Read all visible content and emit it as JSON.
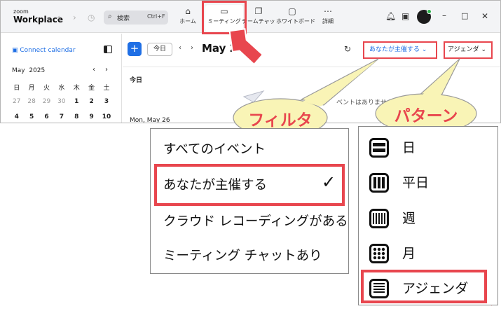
{
  "app": {
    "brand_small": "zoom",
    "brand_big": "Workplace",
    "search": {
      "label": "検索",
      "shortcut": "Ctrl+F"
    },
    "tabs": [
      {
        "label": "ホーム",
        "icon": "home-icon"
      },
      {
        "label": "ミーティング",
        "icon": "video-icon"
      },
      {
        "label": "チームチャット",
        "icon": "chat-icon"
      },
      {
        "label": "ホワイトボード",
        "icon": "whiteboard-icon"
      },
      {
        "label": "詳細",
        "icon": "more-icon"
      }
    ]
  },
  "sidebar": {
    "connect": "Connect calendar",
    "month": "May",
    "year": "2025",
    "weekdays": [
      "日",
      "月",
      "火",
      "水",
      "木",
      "金",
      "土"
    ],
    "weeks": [
      [
        "27",
        "28",
        "29",
        "30",
        "1",
        "2",
        "3"
      ],
      [
        "4",
        "5",
        "6",
        "7",
        "8",
        "9",
        "10"
      ]
    ]
  },
  "main": {
    "today_button": "今日",
    "date_title": "May 26",
    "filter_label": "あなたが主催する",
    "pattern_label": "アジェンダ",
    "today_label": "今日",
    "empty_text": "ベントはありません。",
    "day_label": "Mon, May 26"
  },
  "callouts": {
    "filter": "フィルター",
    "pattern": "パターン"
  },
  "filter_menu": {
    "items": [
      "すべてのイベント",
      "あなたが主催する",
      "クラウド レコーディングがある",
      "ミーティング チャットあり"
    ],
    "checked_index": 1
  },
  "pattern_menu": {
    "items": [
      {
        "label": "日",
        "icon": "day-view-icon"
      },
      {
        "label": "平日",
        "icon": "workweek-view-icon"
      },
      {
        "label": "週",
        "icon": "week-view-icon"
      },
      {
        "label": "月",
        "icon": "month-view-icon"
      },
      {
        "label": "アジェンダ",
        "icon": "agenda-view-icon"
      }
    ],
    "selected_index": 4
  },
  "colors": {
    "accent_blue": "#1f6fe5",
    "highlight_red": "#e8464e",
    "bubble_fill": "#f9f4b6"
  }
}
